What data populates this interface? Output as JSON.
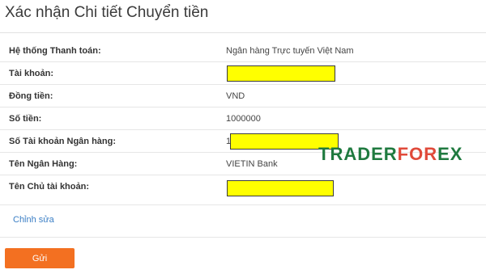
{
  "header": {
    "title": "Xác nhận Chi tiết Chuyển tiền"
  },
  "details": [
    {
      "label": "Hệ thống Thanh toán:",
      "value": "Ngân hàng Trực tuyến Việt Nam"
    },
    {
      "label": "Tài khoản:",
      "value": "",
      "prefix": "",
      "redacted": true
    },
    {
      "label": "Đồng tiền:",
      "value": "VND"
    },
    {
      "label": "Số tiền:",
      "value": "1000000"
    },
    {
      "label": "Số Tài khoản Ngân hàng:",
      "value": "",
      "prefix": "1",
      "redacted": true
    },
    {
      "label": "Tên Ngân Hàng:",
      "value": "VIETIN Bank"
    },
    {
      "label": "Tên Chủ tài khoản:",
      "value": "",
      "prefix": "",
      "redacted": true
    }
  ],
  "actions": {
    "edit_label": "Chỉnh sửa",
    "send_label": "Gửi"
  },
  "watermark": {
    "part1": "TRADER",
    "part2": "FOR",
    "part3": "EX"
  },
  "colors": {
    "redaction": "#ffff00",
    "send_button": "#f37021",
    "link": "#3a7ec5",
    "watermark_green": "#1f7a3f",
    "watermark_red": "#e04a3a"
  }
}
